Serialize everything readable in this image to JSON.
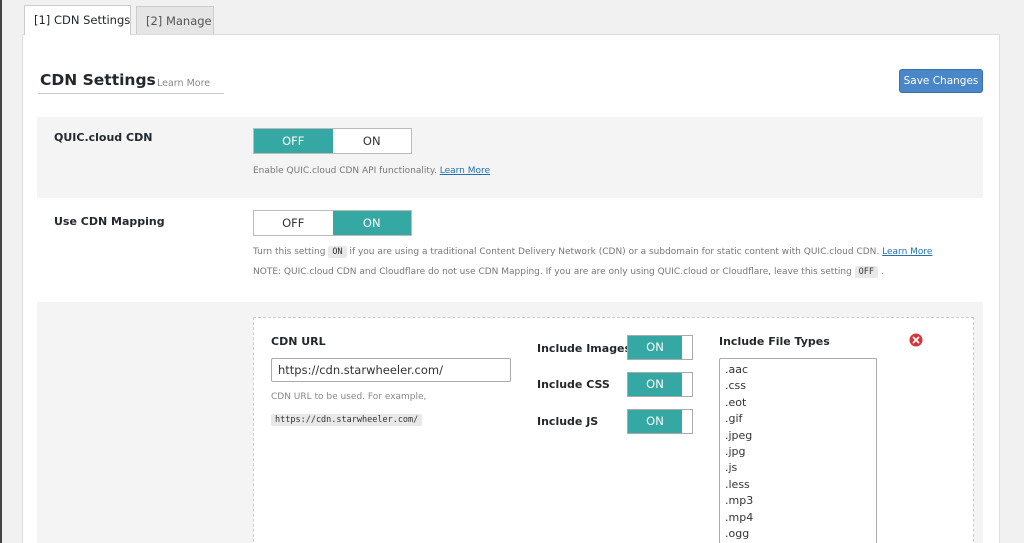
{
  "tabs": [
    {
      "label": "[1] CDN Settings"
    },
    {
      "label": "[2] Manage"
    }
  ],
  "header": {
    "title": "CDN Settings",
    "learn_more": "Learn More",
    "save_label": "Save Changes"
  },
  "quic": {
    "label": "QUIC.cloud CDN",
    "off_label": "OFF",
    "on_label": "ON",
    "selected": "OFF",
    "desc": "Enable QUIC.cloud CDN API functionality.",
    "learn_more": "Learn More"
  },
  "mapping": {
    "label": "Use CDN Mapping",
    "off_label": "OFF",
    "on_label": "ON",
    "selected": "ON",
    "desc1_pre": "Turn this setting",
    "desc1_code": "ON",
    "desc1_post": "if you are using a traditional Content Delivery Network (CDN) or a subdomain for static content with QUIC.cloud CDN.",
    "desc1_link": "Learn More",
    "desc2_pre": "NOTE: QUIC.cloud CDN and Cloudflare do not use CDN Mapping. If you are are only using QUIC.cloud or Cloudflare, leave this setting",
    "desc2_code": "OFF",
    "desc2_post": "."
  },
  "cdn_entry": {
    "url_label": "CDN URL",
    "url_value": "https://cdn.starwheeler.com/",
    "url_help": "CDN URL to be used. For example,",
    "url_example": "https://cdn.starwheeler.com/",
    "include_images_label": "Include Images",
    "include_images_value": "ON",
    "include_css_label": "Include CSS",
    "include_css_value": "ON",
    "include_js_label": "Include JS",
    "include_js_value": "ON",
    "file_types_label": "Include File Types",
    "file_types": [
      ".aac",
      ".css",
      ".eot",
      ".gif",
      ".jpeg",
      ".jpg",
      ".js",
      ".less",
      ".mp3",
      ".mp4",
      ".ogg"
    ]
  },
  "colors": {
    "accent": "#36a8a3",
    "save_button": "#4a87c8",
    "remove_icon": "#d63638"
  }
}
